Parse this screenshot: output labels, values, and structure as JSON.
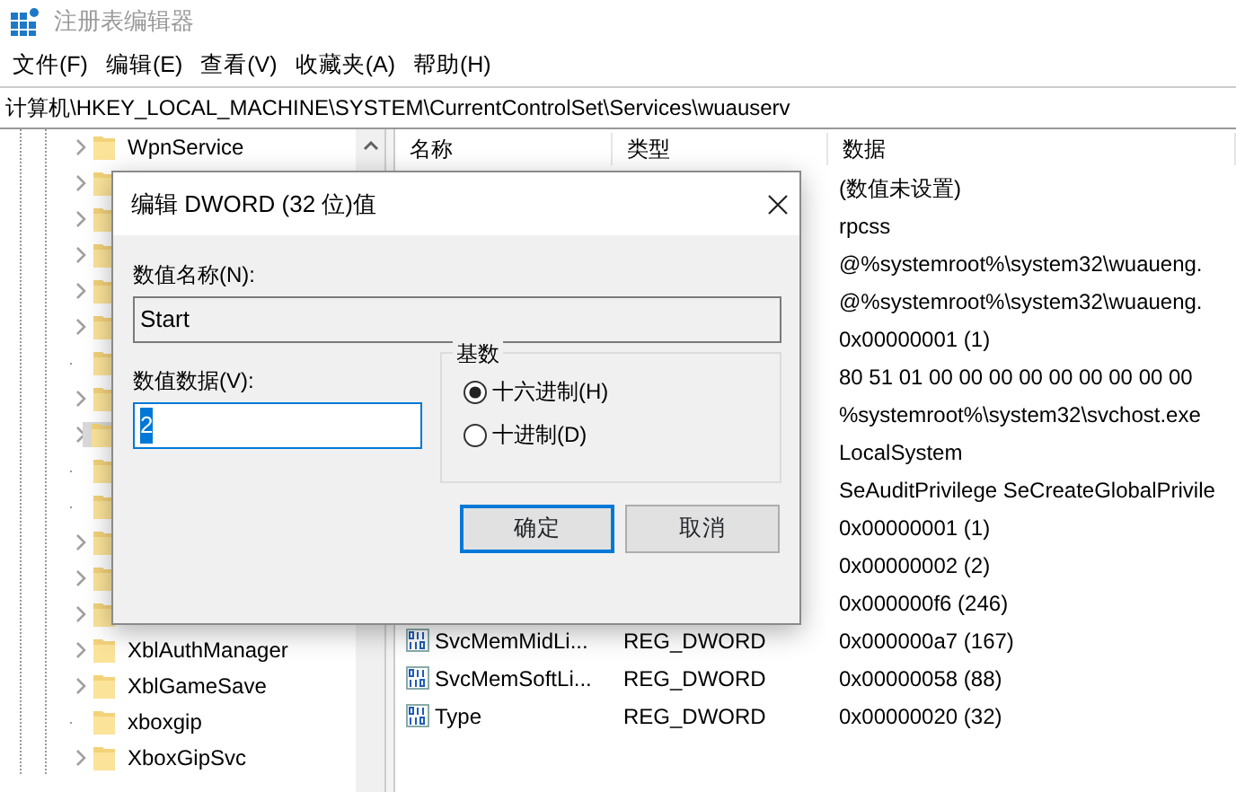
{
  "window": {
    "title": "注册表编辑器"
  },
  "menu": [
    "文件(F)",
    "编辑(E)",
    "查看(V)",
    "收藏夹(A)",
    "帮助(H)"
  ],
  "address": "计算机\\HKEY_LOCAL_MACHINE\\SYSTEM\\CurrentControlSet\\Services\\wuauserv",
  "tree": {
    "items": [
      {
        "label": "WpnService",
        "expandable": true,
        "selected": false
      },
      {
        "expandable": true,
        "selected": false
      },
      {
        "expandable": true,
        "selected": false
      },
      {
        "expandable": true,
        "selected": false
      },
      {
        "expandable": true,
        "selected": false
      },
      {
        "expandable": true,
        "selected": false
      },
      {
        "expandable": false,
        "selected": false
      },
      {
        "expandable": true,
        "selected": false
      },
      {
        "expandable": true,
        "selected": true
      },
      {
        "expandable": false,
        "selected": false
      },
      {
        "expandable": false,
        "selected": false
      },
      {
        "expandable": true,
        "selected": false
      },
      {
        "expandable": true,
        "selected": false
      },
      {
        "expandable": true,
        "selected": false
      },
      {
        "label": "XblAuthManager",
        "expandable": true,
        "selected": false
      },
      {
        "label": "XblGameSave",
        "expandable": true,
        "selected": false
      },
      {
        "label": "xboxgip",
        "expandable": false,
        "selected": false
      },
      {
        "label": "XboxGipSvc",
        "expandable": true,
        "selected": false
      }
    ]
  },
  "values": {
    "columns": [
      "名称",
      "类型",
      "数据"
    ],
    "rows": [
      {
        "data": "(数值未设置)"
      },
      {
        "data": "rpcss"
      },
      {
        "data": "@%systemroot%\\system32\\wuaueng."
      },
      {
        "data": "@%systemroot%\\system32\\wuaueng."
      },
      {
        "data": "0x00000001 (1)"
      },
      {
        "data": "80 51 01 00 00 00 00 00 00 00 00 00"
      },
      {
        "data": "%systemroot%\\system32\\svchost.exe"
      },
      {
        "data": "LocalSystem"
      },
      {
        "data": "SeAuditPrivilege SeCreateGlobalPrivile"
      },
      {
        "data": "0x00000001 (1)"
      },
      {
        "data": "0x00000002 (2)"
      },
      {
        "data": "0x000000f6 (246)"
      },
      {
        "kind": "dword",
        "name": "SvcMemMidLi...",
        "type": "REG_DWORD",
        "data": "0x000000a7 (167)"
      },
      {
        "kind": "dword",
        "name": "SvcMemSoftLi...",
        "type": "REG_DWORD",
        "data": "0x00000058 (88)"
      },
      {
        "kind": "dword",
        "name": "Type",
        "type": "REG_DWORD",
        "data": "0x00000020 (32)"
      }
    ]
  },
  "dialog": {
    "title": "编辑 DWORD (32 位)值",
    "name_label": "数值名称(N):",
    "name_value": "Start",
    "data_label": "数值数据(V):",
    "data_value": "2",
    "base_label": "基数",
    "radios": [
      {
        "label": "十六进制(H)",
        "selected": true
      },
      {
        "label": "十进制(D)",
        "selected": false
      }
    ],
    "buttons": [
      {
        "label": "确定",
        "default": true
      },
      {
        "label": "取消",
        "default": false
      }
    ]
  }
}
